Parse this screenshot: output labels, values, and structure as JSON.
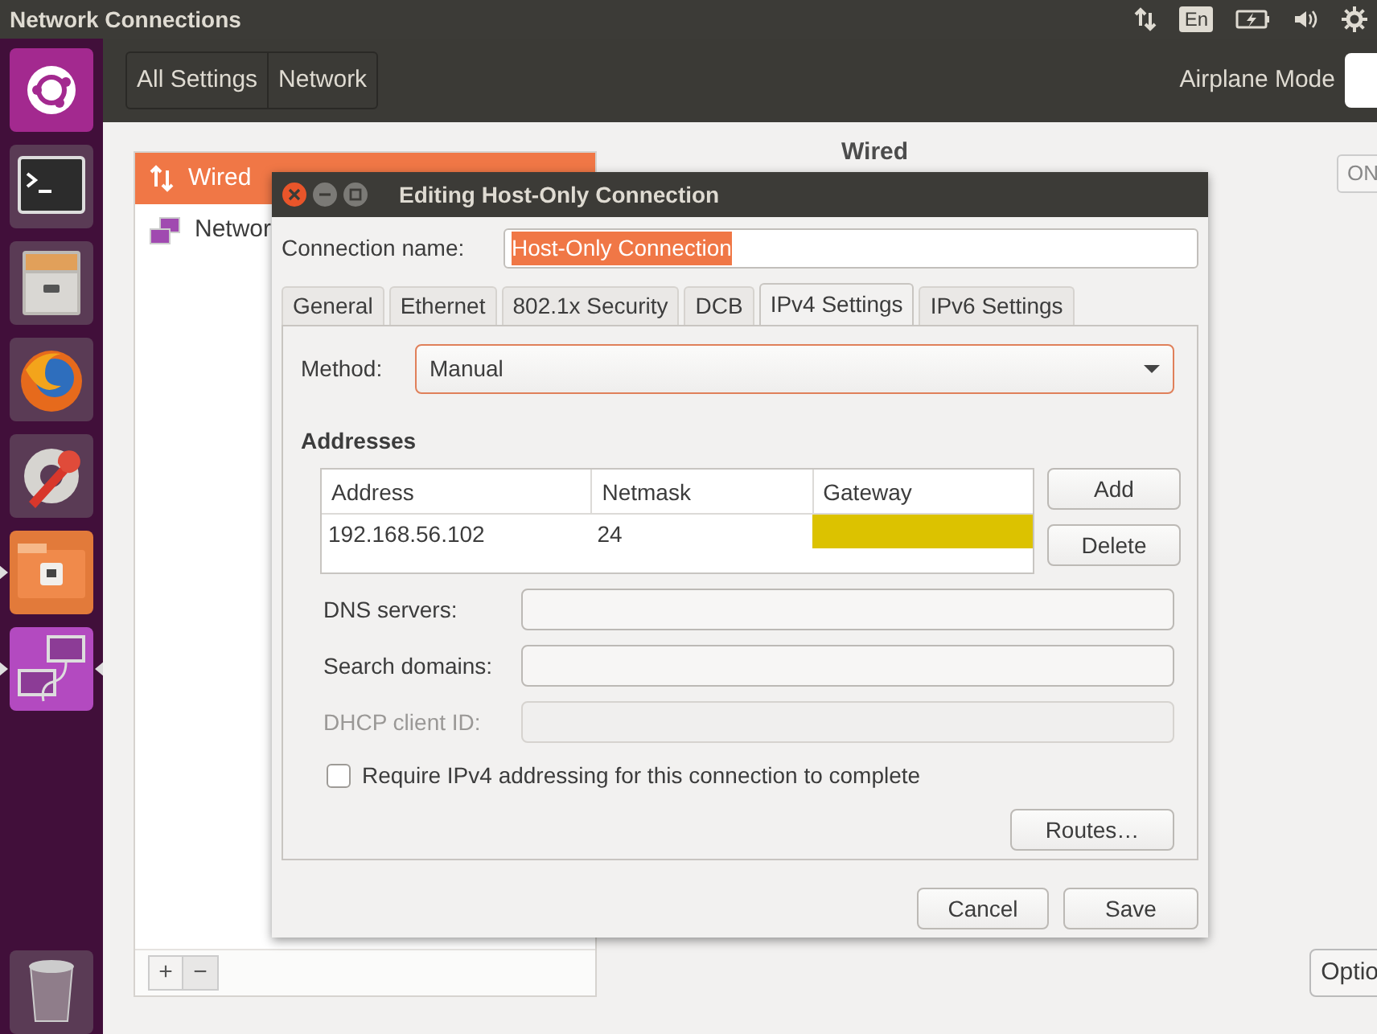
{
  "top_bar": {
    "title": "Network Connections",
    "keyboard_layout": "En"
  },
  "launcher": {
    "items": [
      {
        "kind": "ubuntu",
        "running": false,
        "focused": false
      },
      {
        "kind": "terminal",
        "running": false,
        "focused": false
      },
      {
        "kind": "files",
        "running": false,
        "focused": false
      },
      {
        "kind": "browser",
        "running": false,
        "focused": false
      },
      {
        "kind": "settings",
        "running": false,
        "focused": false
      },
      {
        "kind": "network-folder",
        "running": true,
        "focused": false
      },
      {
        "kind": "network-connections",
        "running": true,
        "focused": true
      },
      {
        "kind": "trash",
        "running": false,
        "focused": false
      }
    ]
  },
  "settings_window": {
    "breadcrumbs": [
      "All Settings",
      "Network"
    ],
    "airplane_mode_label": "Airplane Mode",
    "airplane_mode_on": false,
    "devices": [
      {
        "kind": "wired",
        "label": "Wired",
        "selected": true
      },
      {
        "kind": "network",
        "label": "Networ",
        "selected": false
      }
    ],
    "list_buttons": [
      "+",
      "−"
    ],
    "detail_title": "Wired",
    "switch": {
      "label": "ON",
      "on": true
    },
    "options_button": "Optio"
  },
  "dialog": {
    "title": "Editing Host-Only Connection",
    "connection_name_label": "Connection name:",
    "connection_name": "Host-Only Connection",
    "connection_name_selected": true,
    "tabs": [
      {
        "label": "General",
        "selected": false
      },
      {
        "label": "Ethernet",
        "selected": false
      },
      {
        "label": "802.1x Security",
        "selected": false
      },
      {
        "label": "DCB",
        "selected": false
      },
      {
        "label": "IPv4 Settings",
        "selected": true
      },
      {
        "label": "IPv6 Settings",
        "selected": false
      }
    ],
    "method_label": "Method:",
    "method": "Manual",
    "addresses_heading": "Addresses",
    "address_table": {
      "columns": [
        "Address",
        "Netmask",
        "Gateway"
      ],
      "rows": [
        {
          "address": "192.168.56.102",
          "netmask": "24",
          "gateway_editing": true
        }
      ]
    },
    "table_buttons": [
      "Add",
      "Delete"
    ],
    "fields": [
      {
        "label": "DNS servers:",
        "disabled": false
      },
      {
        "label": "Search domains:",
        "disabled": false
      },
      {
        "label": "DHCP client ID:",
        "disabled": true
      }
    ],
    "require_checkbox": {
      "label": "Require IPv4 addressing for this connection to complete",
      "checked": false
    },
    "routes_button": "Routes…",
    "buttons": [
      "Cancel",
      "Save"
    ]
  }
}
